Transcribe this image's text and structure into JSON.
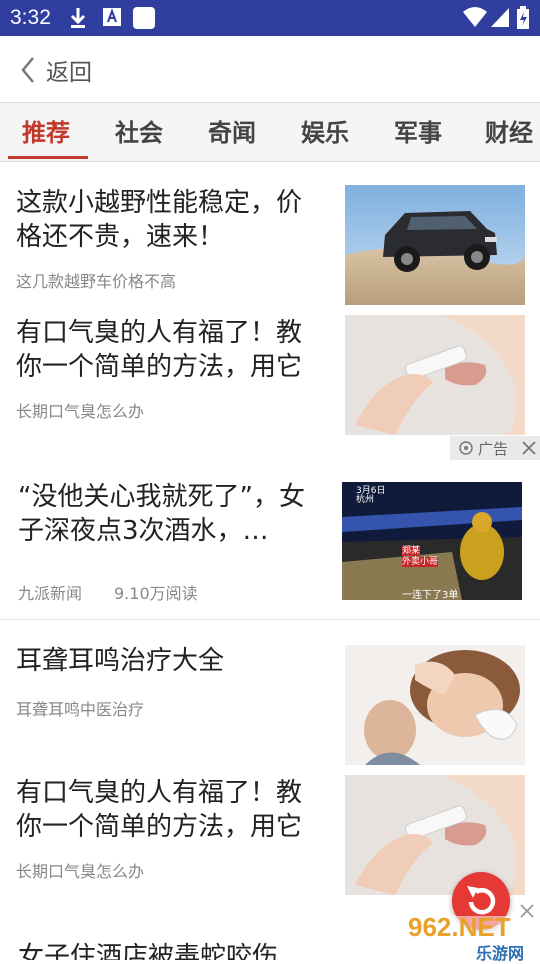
{
  "status_bar": {
    "time": "3:32"
  },
  "header": {
    "back_label": "返回"
  },
  "tabs": [
    {
      "label": "推荐",
      "active": true
    },
    {
      "label": "社会"
    },
    {
      "label": "奇闻"
    },
    {
      "label": "娱乐"
    },
    {
      "label": "军事"
    },
    {
      "label": "财经"
    }
  ],
  "feed": [
    {
      "title": "这款小越野性能稳定，价格还不贵，速来！",
      "subtitle": "这几款越野车价格不高",
      "image": "suv-photo"
    },
    {
      "title": "有口气臭的人有福了！教你一个简单的方法，用它",
      "subtitle": "长期口气臭怎么办",
      "image": "lip-balm-photo"
    },
    {
      "ad_label": "广告"
    },
    {
      "title": "“没他关心我就死了”，女子深夜点3次酒水，…",
      "source": "九派新闻",
      "reads": "9.10万阅读",
      "image": "news-video-still",
      "image_text": {
        "date": "3月6日",
        "city": "杭州",
        "caption": "一连下了3单",
        "tag_line1": "郑某",
        "tag_line2": "外卖小哥"
      }
    },
    {
      "title": "耳聋耳鸣治疗大全",
      "subtitle": "耳聋耳鸣中医治疗",
      "image": "ear-photo"
    },
    {
      "title": "有口气臭的人有福了！教你一个简单的方法，用它",
      "subtitle": "长期口气臭怎么办",
      "image": "lip-balm-photo"
    },
    {
      "title": "女子住酒店被毒蛇咬伤"
    }
  ],
  "watermark": {
    "line1": "962.NET",
    "line2": "乐游网"
  },
  "colors": {
    "status_bar": "#303f9f",
    "accent": "#c0392b",
    "fab": "#e53935"
  }
}
